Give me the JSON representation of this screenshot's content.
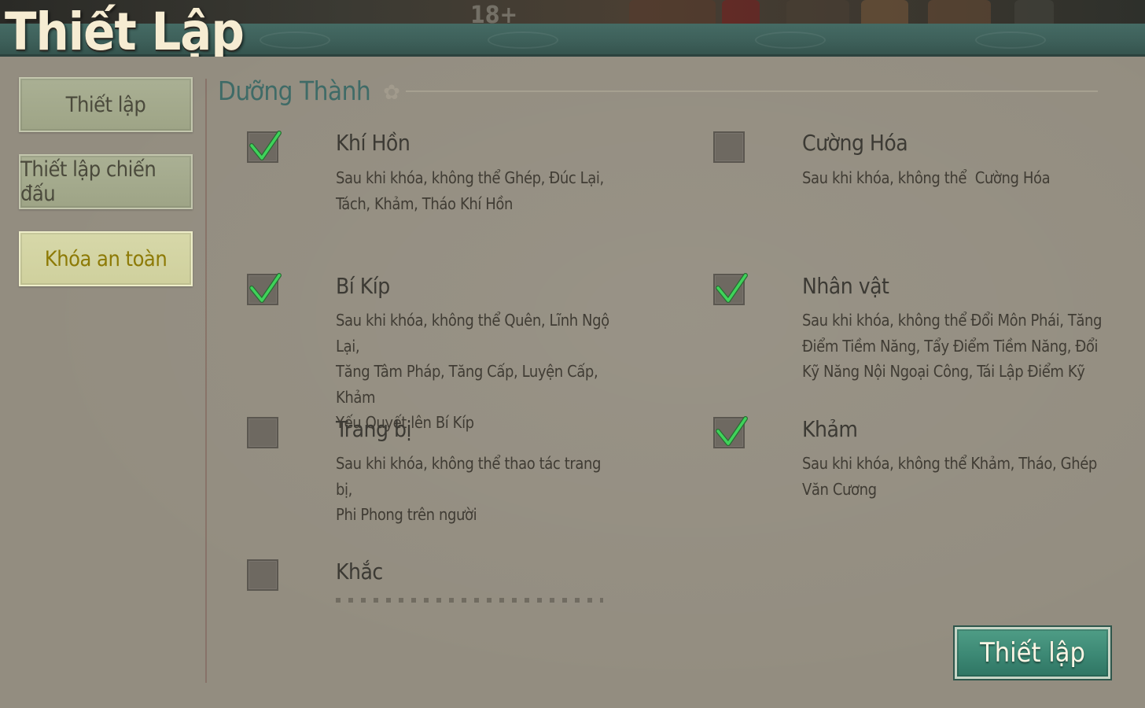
{
  "top_strip": {
    "age_rating": "18+"
  },
  "dialog": {
    "title": "Thiết Lập"
  },
  "sidebar": {
    "items": [
      {
        "label": "Thiết lập",
        "active": false
      },
      {
        "label": "Thiết lập chiến đấu",
        "active": false
      },
      {
        "label": "Khóa an toàn",
        "active": true
      }
    ]
  },
  "section": {
    "title": "Dưỡng Thành"
  },
  "options": [
    {
      "title": "Khí Hồn",
      "checked": true,
      "description": [
        "Sau khi khóa, không thể Ghép, Đúc Lại,",
        "Tách, Khảm, Tháo Khí Hồn"
      ]
    },
    {
      "title": "Cường Hóa",
      "checked": false,
      "description": [
        "Sau khi khóa, không thể  Cường Hóa"
      ]
    },
    {
      "title": "Bí Kíp",
      "checked": true,
      "description": [
        "Sau khi khóa, không thể Quên, Lĩnh Ngộ Lại,",
        "Tăng Tâm Pháp, Tăng Cấp, Luyện Cấp, Khảm",
        "Yếu Quyết lên Bí Kíp"
      ]
    },
    {
      "title": "Nhân vật",
      "checked": true,
      "description": [
        "Sau khi khóa, không thể Đổi Môn Phái, Tăng",
        "Điểm Tiềm Năng, Tẩy Điểm Tiềm Năng, Đổi",
        "Kỹ Năng Nội Ngoại Công, Tái Lập Điểm Kỹ"
      ]
    },
    {
      "title": "Trang bị",
      "checked": false,
      "description": [
        "Sau khi khóa, không thể thao tác trang bị,",
        "Phi Phong trên người"
      ]
    },
    {
      "title": "Khảm",
      "checked": true,
      "description": [
        "Sau khi khóa, không thể Khảm, Tháo, Ghép",
        "Văn Cương"
      ]
    },
    {
      "title": "Khắc",
      "checked": false,
      "description": []
    }
  ],
  "confirm_button": {
    "label": "Thiết lập"
  },
  "colors": {
    "panel_bg": "#938d80",
    "header_band": "#3d5f59",
    "section_title": "#3f6b67",
    "active_tab_text": "#8d7a06",
    "checkmark": "#3fd35a",
    "confirm_button": "#3c8874"
  },
  "icons": {
    "checkmark": "checkmark-icon",
    "section_ornament": "flower-icon"
  }
}
